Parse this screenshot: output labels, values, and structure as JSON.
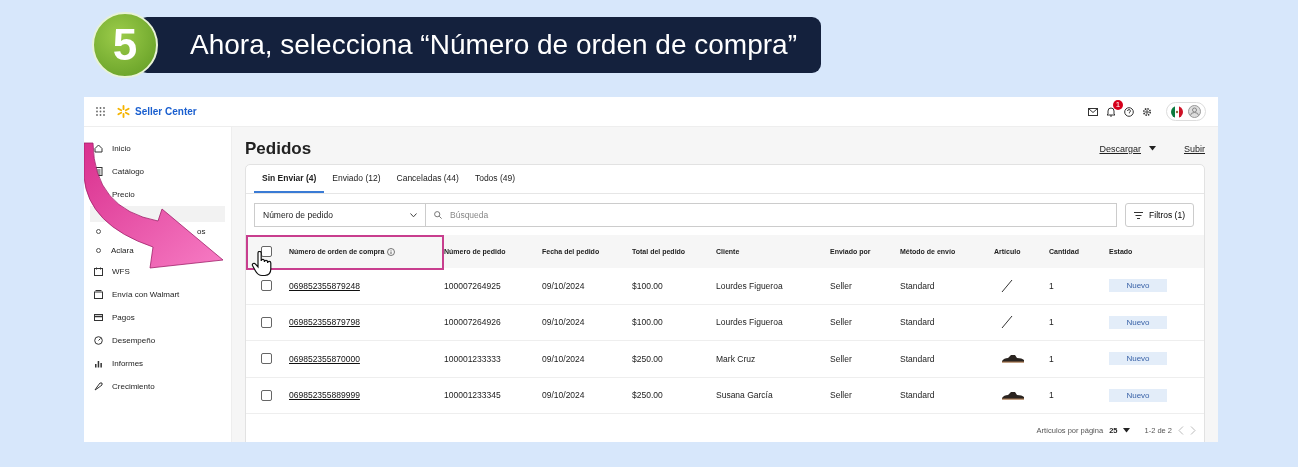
{
  "callout": {
    "step": "5",
    "text": "Ahora, selecciona “Número de orden de compra”"
  },
  "topbar": {
    "brand": "Seller Center",
    "notification_count": "1"
  },
  "sidebar": {
    "items": [
      "Inicio",
      "Catálogo",
      "Precio"
    ],
    "subitems": [
      "os",
      "Aclara"
    ],
    "items2": [
      "WFS",
      "Envía con Walmart",
      "Pagos",
      "Desempeño",
      "Informes",
      "Crecimiento"
    ]
  },
  "page": {
    "title": "Pedidos",
    "download": "Descargar",
    "upload": "Subir"
  },
  "tabs": [
    {
      "label": "Sin Enviar (4)",
      "selected": true
    },
    {
      "label": "Enviado (12)",
      "selected": false
    },
    {
      "label": "Canceladas (44)",
      "selected": false
    },
    {
      "label": "Todos (49)",
      "selected": false
    }
  ],
  "filter": {
    "dropdown": "Número de pedido",
    "search_placeholder": "Búsqueda",
    "filters_button": "Filtros (1)"
  },
  "table": {
    "select_all_checked": false,
    "columns": [
      "Número de orden de compra",
      "Número de pedido",
      "Fecha del pedido",
      "Total del pedido",
      "Cliente",
      "Enviado por",
      "Método de envío",
      "Artículo",
      "Cantidad",
      "Estado"
    ],
    "rows": [
      {
        "checked": false,
        "po": "069852355879248",
        "order": "100007264925",
        "date": "09/10/2024",
        "total": "$100.00",
        "customer": "Lourdes Figueroa",
        "shipped_by": "Seller",
        "method": "Standard",
        "article": {
          "kind": "line"
        },
        "quantity": "1",
        "status": "Nuevo"
      },
      {
        "checked": false,
        "po": "069852355879798",
        "order": "100007264926",
        "date": "09/10/2024",
        "total": "$100.00",
        "customer": "Lourdes Figueroa",
        "shipped_by": "Seller",
        "method": "Standard",
        "article": {
          "kind": "line"
        },
        "quantity": "1",
        "status": "Nuevo"
      },
      {
        "checked": false,
        "po": "069852355870000",
        "order": "100001233333",
        "date": "09/10/2024",
        "total": "$250.00",
        "customer": "Mark Cruz",
        "shipped_by": "Seller",
        "method": "Standard",
        "article": {
          "kind": "sandal"
        },
        "quantity": "1",
        "status": "Nuevo"
      },
      {
        "checked": false,
        "po": "069852355889999",
        "order": "100001233345",
        "date": "09/10/2024",
        "total": "$250.00",
        "customer": "Susana García",
        "shipped_by": "Seller",
        "method": "Standard",
        "article": {
          "kind": "sandal"
        },
        "quantity": "1",
        "status": "Nuevo"
      }
    ],
    "pagination": {
      "per_page_label": "Artículos por página",
      "per_page": "25",
      "range": "1-2 de 2"
    }
  }
}
